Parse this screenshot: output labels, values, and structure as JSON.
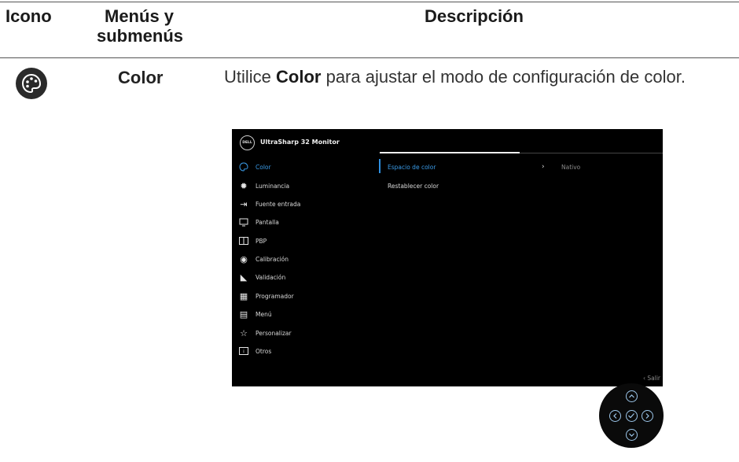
{
  "table": {
    "headers": {
      "icon": "Icono",
      "menu_line1": "Menús y",
      "menu_line2": "submenús",
      "description": "Descripción"
    },
    "row": {
      "menu_name": "Color",
      "icon_name": "palette-icon",
      "desc_prefix": "Utilice ",
      "desc_bold": "Color",
      "desc_suffix": " para ajustar el modo de configuración de color."
    }
  },
  "osd": {
    "brand": "DELL",
    "model": "UltraSharp 32 Monitor",
    "menu_items": [
      {
        "label": "Color",
        "icon": "palette-icon",
        "active": true
      },
      {
        "label": "Luminancia",
        "icon": "brightness-icon",
        "active": false
      },
      {
        "label": "Fuente entrada",
        "icon": "input-source-icon",
        "active": false
      },
      {
        "label": "Pantalla",
        "icon": "display-icon",
        "active": false
      },
      {
        "label": "PBP",
        "icon": "pbp-icon",
        "active": false
      },
      {
        "label": "Calibración",
        "icon": "calibration-icon",
        "active": false
      },
      {
        "label": "Validación",
        "icon": "validation-icon",
        "active": false
      },
      {
        "label": "Programador",
        "icon": "scheduler-icon",
        "active": false
      },
      {
        "label": "Menú",
        "icon": "menu-icon",
        "active": false
      },
      {
        "label": "Personalizar",
        "icon": "star-icon",
        "active": false
      },
      {
        "label": "Otros",
        "icon": "others-icon",
        "active": false
      }
    ],
    "submenu": [
      {
        "label": "Espacio de color",
        "active": true
      },
      {
        "label": "Restablecer color",
        "active": false
      }
    ],
    "selected_value": "Nativo",
    "exit_label": "Salir",
    "colors": {
      "accent": "#3a9be8",
      "background": "#000000"
    }
  },
  "joystick": {
    "buttons": [
      "up-icon",
      "left-icon",
      "confirm-icon",
      "right-icon",
      "down-icon"
    ],
    "color": "#9cc6ea"
  }
}
